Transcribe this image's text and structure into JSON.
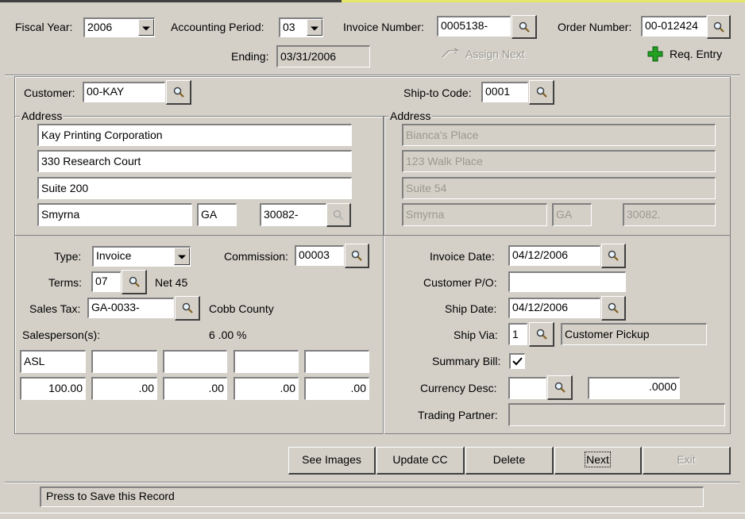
{
  "header": {
    "fiscal_year_label": "Fiscal Year:",
    "fiscal_year": "2006",
    "period_label": "Accounting Period:",
    "period": "03",
    "invoice_label": "Invoice Number:",
    "invoice": "0005138-",
    "order_label": "Order Number:",
    "order": "00-012424",
    "ending_label": "Ending:",
    "ending": "03/31/2006",
    "assign_next": "Assign Next",
    "req_entry": "Req. Entry"
  },
  "customer": {
    "label": "Customer:",
    "code": "00-KAY",
    "address_title": "Address",
    "line1": "Kay Printing Corporation",
    "line2": "330 Research Court",
    "line3": "Suite 200",
    "city": "Smyrna",
    "state": "GA",
    "zip": "30082-"
  },
  "shipto": {
    "label": "Ship-to Code:",
    "code": "0001",
    "address_title": "Address",
    "line1": "Bianca's Place",
    "line2": "123 Walk Place",
    "line3": "Suite 54",
    "city": "Smyrna",
    "state": "GA",
    "zip": "30082."
  },
  "terms": {
    "type_label": "Type:",
    "type": "Invoice",
    "commission_label": "Commission:",
    "commission": "00003",
    "terms_label": "Terms:",
    "terms": "07",
    "terms_desc": "Net 45",
    "tax_label": "Sales Tax:",
    "tax": "GA-0033-",
    "tax_desc": "Cobb County",
    "salesperson_label": "Salesperson(s):",
    "pct_total": "6 .00 %",
    "salespersons": [
      "ASL",
      "",
      "",
      "",
      ""
    ],
    "percents": [
      "100.00",
      ".00",
      ".00",
      ".00",
      ".00"
    ]
  },
  "invoice": {
    "date_label": "Invoice Date:",
    "date": "04/12/2006",
    "po_label": "Customer P/O:",
    "po": "",
    "ship_date_label": "Ship Date:",
    "ship_date": "04/12/2006",
    "ship_via_label": "Ship Via:",
    "ship_via": "1",
    "ship_via_desc": "Customer Pickup",
    "summary_label": "Summary Bill:",
    "summary_checked": true,
    "currency_label": "Currency Desc:",
    "currency": "",
    "currency_rate": ".0000",
    "trading_label": "Trading Partner:",
    "trading": ""
  },
  "buttons": {
    "see_images": "See Images",
    "update_cc": "Update CC",
    "delete": "Delete",
    "next": "Next",
    "exit": "Exit"
  },
  "status": {
    "text": "Press to Save this Record"
  }
}
